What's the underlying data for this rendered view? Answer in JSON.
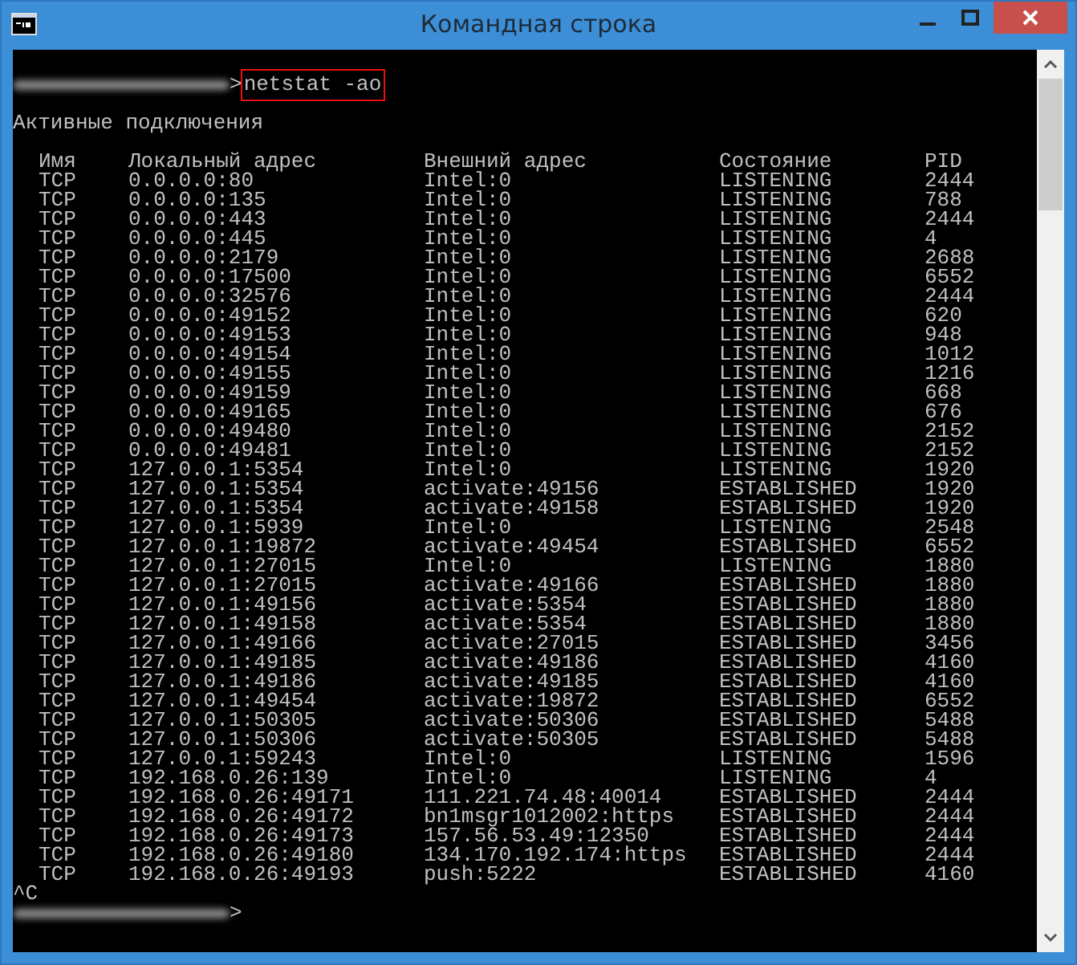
{
  "window": {
    "title": "Командная строка"
  },
  "console": {
    "command_prompt": ">",
    "command": "netstat -ao",
    "heading": "Активные подключения",
    "columns": [
      "Имя",
      "Локальный адрес",
      "Внешний адрес",
      "Состояние",
      "PID"
    ],
    "rows": [
      [
        "TCP",
        "0.0.0.0:80",
        "Intel:0",
        "LISTENING",
        "2444"
      ],
      [
        "TCP",
        "0.0.0.0:135",
        "Intel:0",
        "LISTENING",
        "788"
      ],
      [
        "TCP",
        "0.0.0.0:443",
        "Intel:0",
        "LISTENING",
        "2444"
      ],
      [
        "TCP",
        "0.0.0.0:445",
        "Intel:0",
        "LISTENING",
        "4"
      ],
      [
        "TCP",
        "0.0.0.0:2179",
        "Intel:0",
        "LISTENING",
        "2688"
      ],
      [
        "TCP",
        "0.0.0.0:17500",
        "Intel:0",
        "LISTENING",
        "6552"
      ],
      [
        "TCP",
        "0.0.0.0:32576",
        "Intel:0",
        "LISTENING",
        "2444"
      ],
      [
        "TCP",
        "0.0.0.0:49152",
        "Intel:0",
        "LISTENING",
        "620"
      ],
      [
        "TCP",
        "0.0.0.0:49153",
        "Intel:0",
        "LISTENING",
        "948"
      ],
      [
        "TCP",
        "0.0.0.0:49154",
        "Intel:0",
        "LISTENING",
        "1012"
      ],
      [
        "TCP",
        "0.0.0.0:49155",
        "Intel:0",
        "LISTENING",
        "1216"
      ],
      [
        "TCP",
        "0.0.0.0:49159",
        "Intel:0",
        "LISTENING",
        "668"
      ],
      [
        "TCP",
        "0.0.0.0:49165",
        "Intel:0",
        "LISTENING",
        "676"
      ],
      [
        "TCP",
        "0.0.0.0:49480",
        "Intel:0",
        "LISTENING",
        "2152"
      ],
      [
        "TCP",
        "0.0.0.0:49481",
        "Intel:0",
        "LISTENING",
        "2152"
      ],
      [
        "TCP",
        "127.0.0.1:5354",
        "Intel:0",
        "LISTENING",
        "1920"
      ],
      [
        "TCP",
        "127.0.0.1:5354",
        "activate:49156",
        "ESTABLISHED",
        "1920"
      ],
      [
        "TCP",
        "127.0.0.1:5354",
        "activate:49158",
        "ESTABLISHED",
        "1920"
      ],
      [
        "TCP",
        "127.0.0.1:5939",
        "Intel:0",
        "LISTENING",
        "2548"
      ],
      [
        "TCP",
        "127.0.0.1:19872",
        "activate:49454",
        "ESTABLISHED",
        "6552"
      ],
      [
        "TCP",
        "127.0.0.1:27015",
        "Intel:0",
        "LISTENING",
        "1880"
      ],
      [
        "TCP",
        "127.0.0.1:27015",
        "activate:49166",
        "ESTABLISHED",
        "1880"
      ],
      [
        "TCP",
        "127.0.0.1:49156",
        "activate:5354",
        "ESTABLISHED",
        "1880"
      ],
      [
        "TCP",
        "127.0.0.1:49158",
        "activate:5354",
        "ESTABLISHED",
        "1880"
      ],
      [
        "TCP",
        "127.0.0.1:49166",
        "activate:27015",
        "ESTABLISHED",
        "3456"
      ],
      [
        "TCP",
        "127.0.0.1:49185",
        "activate:49186",
        "ESTABLISHED",
        "4160"
      ],
      [
        "TCP",
        "127.0.0.1:49186",
        "activate:49185",
        "ESTABLISHED",
        "4160"
      ],
      [
        "TCP",
        "127.0.0.1:49454",
        "activate:19872",
        "ESTABLISHED",
        "6552"
      ],
      [
        "TCP",
        "127.0.0.1:50305",
        "activate:50306",
        "ESTABLISHED",
        "5488"
      ],
      [
        "TCP",
        "127.0.0.1:50306",
        "activate:50305",
        "ESTABLISHED",
        "5488"
      ],
      [
        "TCP",
        "127.0.0.1:59243",
        "Intel:0",
        "LISTENING",
        "1596"
      ],
      [
        "TCP",
        "192.168.0.26:139",
        "Intel:0",
        "LISTENING",
        "4"
      ],
      [
        "TCP",
        "192.168.0.26:49171",
        "111.221.74.48:40014",
        "ESTABLISHED",
        "2444"
      ],
      [
        "TCP",
        "192.168.0.26:49172",
        "bn1msgr1012002:https",
        "ESTABLISHED",
        "2444"
      ],
      [
        "TCP",
        "192.168.0.26:49173",
        "157.56.53.49:12350",
        "ESTABLISHED",
        "2444"
      ],
      [
        "TCP",
        "192.168.0.26:49180",
        "134.170.192.174:https",
        "ESTABLISHED",
        "2444"
      ],
      [
        "TCP",
        "192.168.0.26:49193",
        "push:5222",
        "ESTABLISHED",
        "4160"
      ]
    ],
    "interrupt": "^C",
    "final_prompt": ">"
  }
}
